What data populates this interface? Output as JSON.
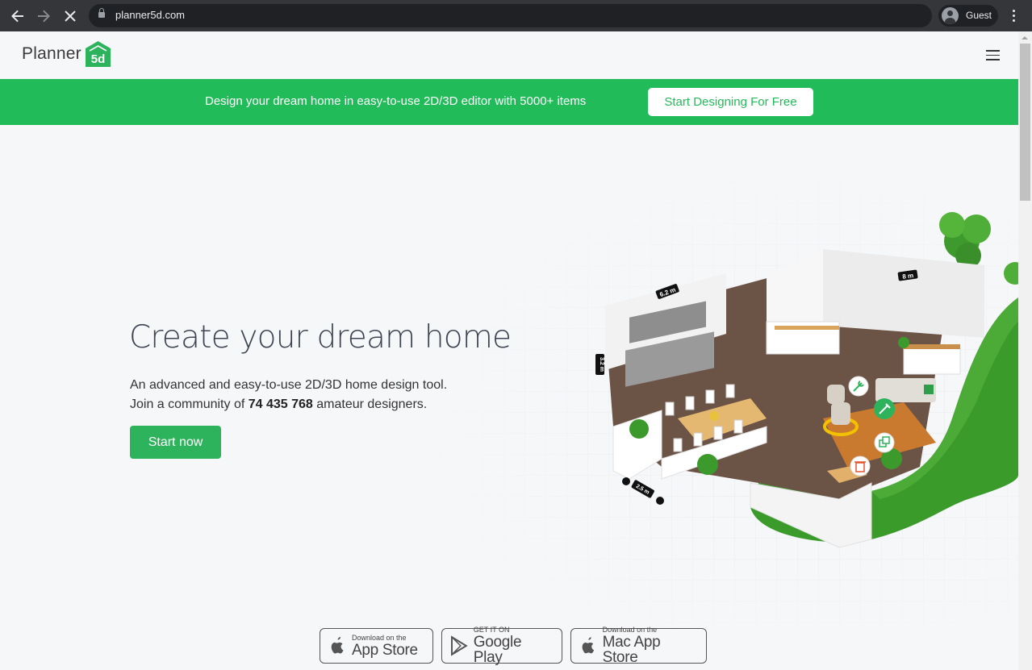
{
  "browser": {
    "url": "planner5d.com",
    "profile_label": "Guest",
    "back_icon": "arrow-left-icon",
    "forward_icon": "arrow-right-icon",
    "stop_icon": "close-icon",
    "lock_icon": "lock-icon",
    "menu_icon": "more-vert-icon"
  },
  "header": {
    "logo_word": "Planner",
    "logo_badge": "5d",
    "menu_icon": "hamburger-icon"
  },
  "banner": {
    "text": "Design your dream home in easy-to-use 2D/3D editor with 5000+ items",
    "cta_label": "Start Designing For Free",
    "color": "#22bb59"
  },
  "hero": {
    "title": "Create your dream home",
    "line1": "An advanced and easy-to-use 2D/3D home design tool.",
    "line2_prefix": "Join a community of ",
    "designer_count": "74 435 768",
    "line2_suffix": " amateur designers.",
    "start_label": "Start now"
  },
  "illustration": {
    "dimension_labels": [
      "6.2 m",
      "8 m",
      "3.2 m",
      "2.5 m"
    ],
    "tool_icons": [
      "wrench-icon",
      "paint-brush-icon",
      "copy-icon",
      "trash-icon"
    ]
  },
  "stores": [
    {
      "small": "Download on the",
      "big": "App Store",
      "icon": "apple-icon"
    },
    {
      "small": "GET IT ON",
      "big": "Google Play",
      "icon": "google-play-icon"
    },
    {
      "small": "Download on the",
      "big": "Mac App Store",
      "icon": "apple-icon"
    }
  ]
}
